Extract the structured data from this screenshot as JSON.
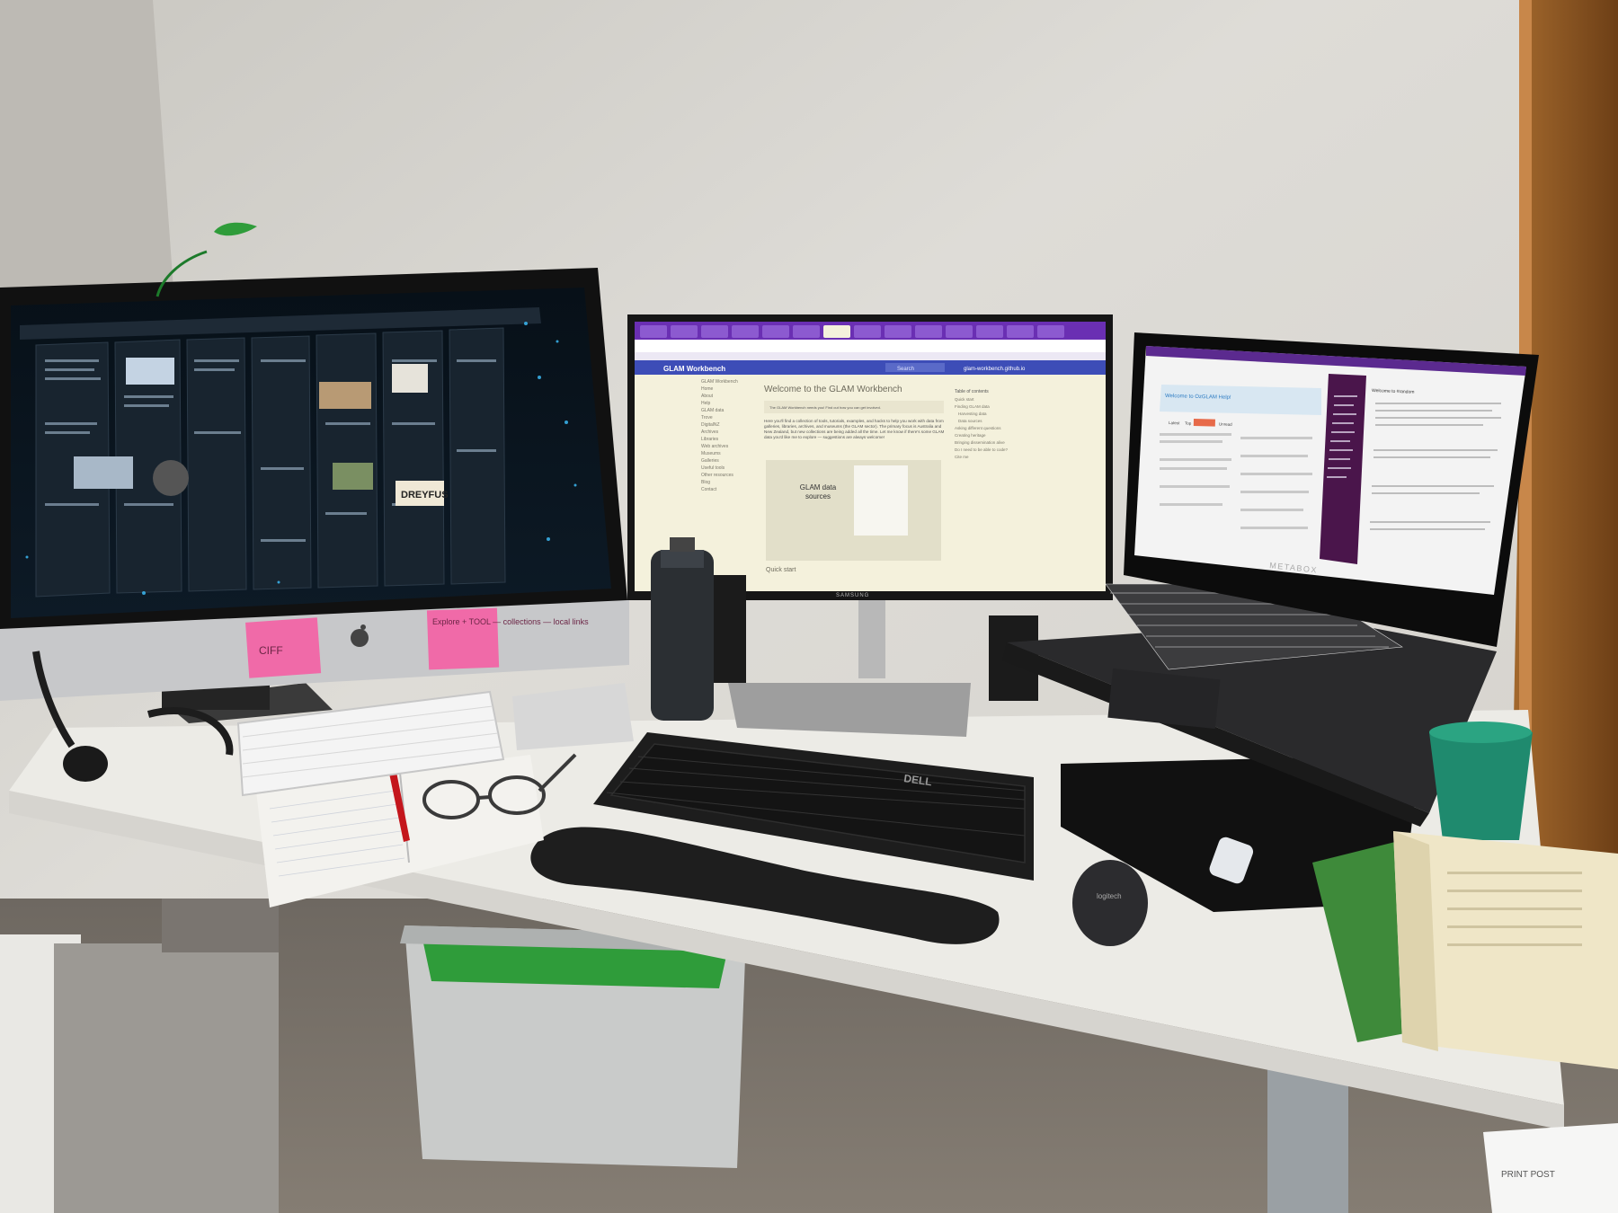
{
  "colors": {
    "wall": "#dcdad5",
    "desk": "#ecebe6",
    "imac_screen_bg": "#0f1720",
    "browser_accent": "#6a2fb3",
    "notes_pink": "#f06aa8",
    "monitor_page_bg": "#f4f1dc",
    "cup": "#1f8a6e"
  },
  "imac": {
    "app": "social-media-dashboard",
    "tile_text": "DREYFUS",
    "sticky_notes": [
      "CIFF",
      "Explore + TOOL — collections — local links"
    ]
  },
  "center_monitor": {
    "site_title": "GLAM Workbench",
    "search_placeholder": "Search",
    "repo_link": "glam-workbench.github.io",
    "page_heading": "Welcome to the GLAM Workbench",
    "notice": "The GLAM Workbench needs you! Find out how you can get involved.",
    "intro": "Here you'll find a collection of tools, tutorials, examples, and hacks to help you work with data from galleries, libraries, archives, and museums (the GLAM sector). The primary focus is Australia and New Zealand, but new collections are being added all the time. Let me know if there's some GLAM data you'd like me to explore — suggestions are always welcome!",
    "slide_title": "GLAM data sources",
    "section": "Quick start",
    "toc_title": "Table of contents",
    "toc": [
      "Quick start",
      "Finding GLAM data",
      "Harvesting data",
      "Data sources",
      "Asking different questions",
      "Creating heritage",
      "Bringing dissemination alive",
      "Do I need to be able to code?",
      "Cite me"
    ],
    "sidebar": [
      "GLAM Workbench",
      "Home",
      "About",
      "Help",
      "GLAM data",
      "Trove",
      "DigitalNZ",
      "Archives",
      "Libraries",
      "Web archives",
      "Museums",
      "Galleries",
      "Useful tools",
      "Other resources",
      "Blog",
      "Contact"
    ],
    "brand": "SAMSUNG"
  },
  "laptop": {
    "forum_heading": "Welcome to OzGLAM Help!",
    "forum_tabs": [
      "Latest",
      "Top",
      "Categories",
      "Unread"
    ],
    "chat_heading": "Welcome to #random",
    "brand": "METABOX"
  },
  "keyboard_brand": "DELL",
  "mouse_brand": "logitech",
  "apple_logo": "apple-logo",
  "box_label": "PRINT POST"
}
